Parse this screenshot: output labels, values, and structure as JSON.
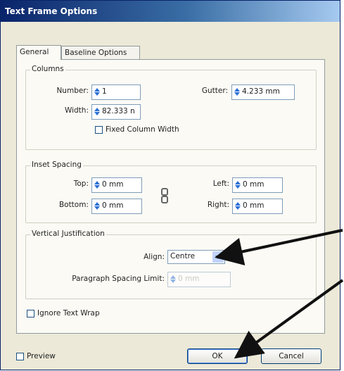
{
  "dialog": {
    "title": "Text Frame Options",
    "tabs": [
      {
        "label": "General"
      },
      {
        "label": "Baseline Options"
      }
    ],
    "columns": {
      "legend": "Columns",
      "number_label": "Number:",
      "number_value": "1",
      "gutter_label": "Gutter:",
      "gutter_value": "4.233 mm",
      "width_label": "Width:",
      "width_value": "82.333 n",
      "fixed_width_label": "Fixed Column Width",
      "fixed_width_checked": false
    },
    "inset": {
      "legend": "Inset Spacing",
      "top_label": "Top:",
      "top_value": "0 mm",
      "bottom_label": "Bottom:",
      "bottom_value": "0 mm",
      "left_label": "Left:",
      "left_value": "0 mm",
      "right_label": "Right:",
      "right_value": "0 mm",
      "link_icon": "chain-link-icon"
    },
    "vertical": {
      "legend": "Vertical Justification",
      "align_label": "Align:",
      "align_value": "Centre",
      "para_limit_label": "Paragraph Spacing Limit:",
      "para_limit_value": "0 mm"
    },
    "ignore_wrap_label": "Ignore Text Wrap",
    "ignore_wrap_checked": false,
    "preview_label": "Preview",
    "preview_checked": false,
    "ok_label": "OK",
    "cancel_label": "Cancel"
  },
  "colors": {
    "accent": "#0a246a",
    "field_border": "#7f9db9",
    "dialog_bg": "#ece9d8"
  }
}
